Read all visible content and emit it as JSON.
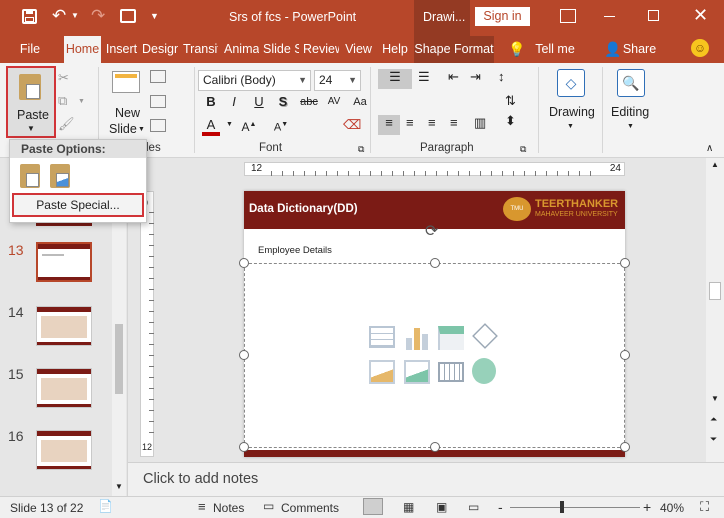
{
  "title_bar": {
    "doc_title": "Srs of fcs",
    "separator": "-",
    "app_name": "PowerPoint",
    "context_tab": "Drawi...",
    "signin": "Sign in"
  },
  "tabs": [
    "File",
    "Home",
    "Insert",
    "Design",
    "Transitions",
    "Animations",
    "Slide Show",
    "Review",
    "View",
    "Help",
    "Shape Format"
  ],
  "tell_me": "Tell me",
  "share": "Share",
  "ribbon": {
    "paste": "Paste",
    "new_slide_1": "New",
    "new_slide_2": "Slide",
    "slides_group_fragment": "les",
    "font_name": "Calibri (Body)",
    "font_size": "24",
    "font_group": "Font",
    "paragraph_group": "Paragraph",
    "drawing": "Drawing",
    "editing": "Editing",
    "bold": "B",
    "italic": "I",
    "underline": "U",
    "shadow": "S",
    "strike": "abc",
    "spacing": "AV",
    "case": "Aa",
    "font_color": "A"
  },
  "paste_menu": {
    "header": "Paste Options:",
    "special": "Paste Special..."
  },
  "slides": [
    "13",
    "14",
    "15",
    "16"
  ],
  "slide": {
    "title": "Data Dictionary(DD)",
    "subtitle": "Employee Details",
    "logo_line1": "TEERTHANKER",
    "logo_line2": "MAHAVEER UNIVERSITY",
    "logo_badge": "TMU"
  },
  "ruler": {
    "left": "12",
    "right": "24",
    "v_top": "9",
    "v_bottom": "12"
  },
  "notes_placeholder": "Click to add notes",
  "status": {
    "slide_info": "Slide 13 of 22",
    "notes": "Notes",
    "comments": "Comments",
    "zoom_minus": "-",
    "zoom_plus": "+",
    "zoom": "40%"
  },
  "colors": {
    "accent": "#b7472a",
    "dark_red": "#7b1b15",
    "highlight": "#d13438"
  }
}
